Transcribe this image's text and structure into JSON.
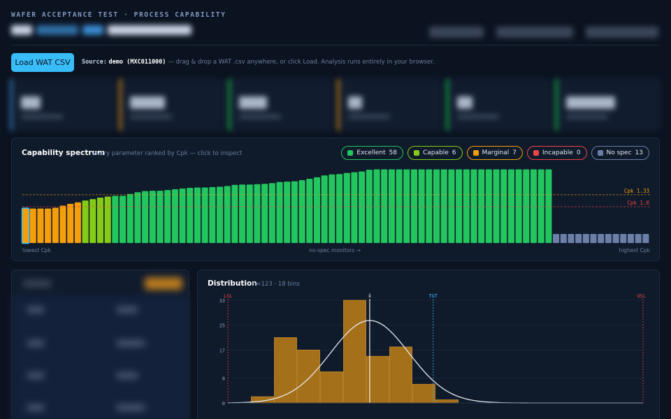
{
  "header": {
    "kicker": "WAFER ACCEPTANCE TEST · PROCESS CAPABILITY"
  },
  "toolbar": {
    "load_label": "Load WAT CSV",
    "source_label": "Source:",
    "source_value": "demo (MXC011000)",
    "hint": "— drag & drop a WAT .csv anywhere, or click Load. Analysis runs entirely in your browser."
  },
  "spectrum": {
    "title": "Capability spectrum",
    "subtitle": "every parameter ranked by Cpk — click to inspect",
    "legend": [
      {
        "label": "Excellent",
        "count": "58",
        "color": "#22c55e"
      },
      {
        "label": "Capable",
        "count": "6",
        "color": "#84cc16"
      },
      {
        "label": "Marginal",
        "count": "7",
        "color": "#f59e0b"
      },
      {
        "label": "Incapable",
        "count": "0",
        "color": "#ef4444"
      },
      {
        "label": "No spec",
        "count": "13",
        "color": "#6b7fa8"
      }
    ],
    "ref_lines": [
      {
        "label": "Cpk 1.33",
        "value": 1.33,
        "color": "#f59e0b"
      },
      {
        "label": "Cpk 1.0",
        "value": 1.0,
        "color": "#ef4444"
      }
    ],
    "footer_left": "lowest Cpk",
    "footer_mid": "no-spec monitors →",
    "footer_right": "highest Cpk"
  },
  "chart_data": [
    {
      "type": "bar",
      "title": "Capability spectrum",
      "ylim": [
        0,
        2.5
      ],
      "values": [
        0.95,
        0.95,
        0.95,
        0.95,
        0.97,
        1.03,
        1.08,
        1.12,
        1.17,
        1.21,
        1.25,
        1.28,
        1.3,
        1.3,
        1.35,
        1.4,
        1.43,
        1.44,
        1.44,
        1.46,
        1.48,
        1.5,
        1.52,
        1.53,
        1.53,
        1.54,
        1.55,
        1.57,
        1.6,
        1.61,
        1.61,
        1.62,
        1.63,
        1.65,
        1.68,
        1.69,
        1.7,
        1.73,
        1.77,
        1.81,
        1.86,
        1.89,
        1.9,
        1.93,
        1.95,
        1.97,
        2.02,
        2.03,
        2.03,
        2.03,
        2.03,
        2.03,
        2.03,
        2.03,
        2.03,
        2.03,
        2.03,
        2.03,
        2.03,
        2.03,
        2.03,
        2.03,
        2.03,
        2.03,
        2.03,
        2.03,
        2.03,
        2.03,
        2.03,
        2.03,
        2.03
      ],
      "no_spec_count": 13,
      "selected_index": 0
    },
    {
      "type": "bar",
      "title": "Distribution",
      "subtitle": "n=123 · 18 bins",
      "bins": 18,
      "values": [
        0,
        2,
        21,
        17,
        10,
        33,
        15,
        18,
        6,
        1,
        0,
        0,
        0,
        0,
        0,
        0,
        0,
        0
      ],
      "yticks": [
        0,
        8,
        17,
        25,
        33
      ],
      "ylim": [
        0,
        33
      ],
      "markers": [
        {
          "label": "LSL",
          "bin": 0,
          "color": "#ef4444"
        },
        {
          "label": "x̄",
          "bin": 6.15,
          "color": "#ffffff"
        },
        {
          "label": "TGT",
          "bin": 8.9,
          "color": "#38bdf8"
        },
        {
          "label": "USL",
          "bin": 18,
          "color": "#ef4444"
        }
      ],
      "fit_peak": 26.5,
      "fit_mean_bin": 6.15,
      "fit_sd_bins": 1.7
    }
  ],
  "distribution": {
    "title": "Distribution",
    "subtitle": "n=123 · 18 bins"
  }
}
